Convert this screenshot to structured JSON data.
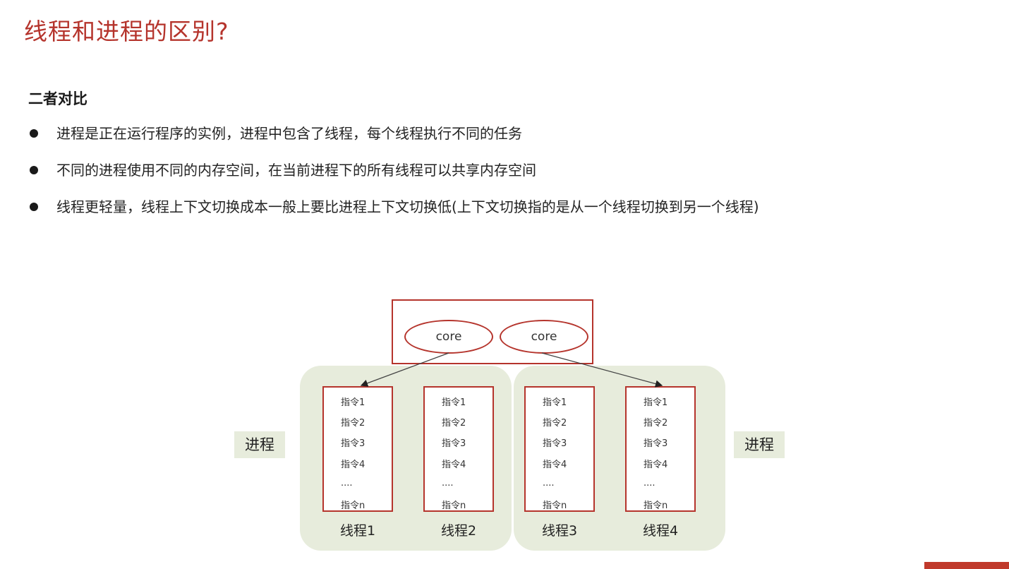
{
  "title": "线程和进程的区别?",
  "section": "二者对比",
  "bullets": [
    "进程是正在运行程序的实例，进程中包含了线程，每个线程执行不同的任务",
    "不同的进程使用不同的内存空间，在当前进程下的所有线程可以共享内存空间",
    "线程更轻量，线程上下文切换成本一般上要比进程上下文切换低(上下文切换指的是从一个线程切换到另一个线程)"
  ],
  "diagram": {
    "cores": [
      "core",
      "core"
    ],
    "process_label": "进程",
    "instructions": [
      "指令1",
      "指令2",
      "指令3",
      "指令4",
      "....",
      "指令n"
    ],
    "threads": [
      "线程1",
      "线程2",
      "线程3",
      "线程4"
    ]
  },
  "colors": {
    "accent": "#b5342c",
    "process_bg": "#e7ecdc"
  }
}
